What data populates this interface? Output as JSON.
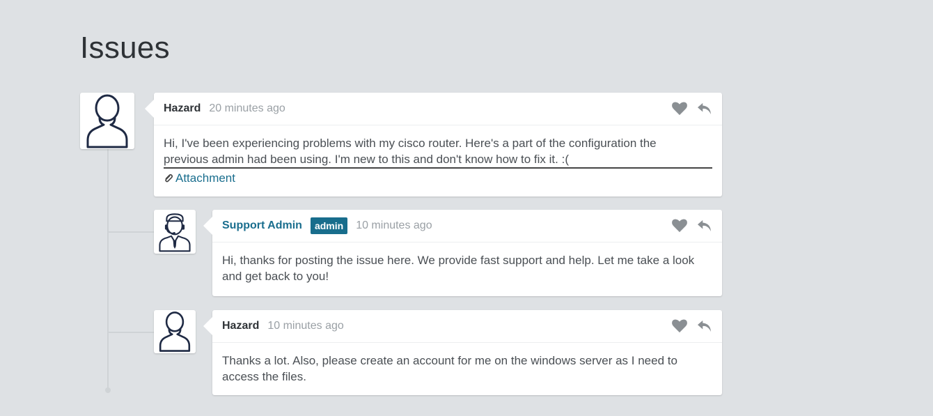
{
  "page": {
    "title": "Issues"
  },
  "comments": [
    {
      "author": "Hazard",
      "time": "20 minutes ago",
      "text_line1": "Hi, I've been experiencing problems with my cisco router. Here's a part of the configuration the",
      "text_line2": "previous admin had been using. I'm new to this and don't know how to fix it. :(",
      "attachment_label": "Attachment"
    },
    {
      "author": "Support Admin",
      "badge": "admin",
      "time": "10 minutes ago",
      "text": "Hi, thanks for posting the issue here. We provide fast support and help. Let me take a look and get back to you!"
    },
    {
      "author": "Hazard",
      "time": "10 minutes ago",
      "text": "Thanks a lot. Also, please create an account for me on the windows server as I need to access the files."
    }
  ],
  "icons": {
    "like": "heart-icon",
    "reply": "reply-icon",
    "attachment": "paperclip-icon"
  },
  "colors": {
    "background": "#dee1e4",
    "accent": "#1a6e8e",
    "badge": "#186d8c"
  }
}
